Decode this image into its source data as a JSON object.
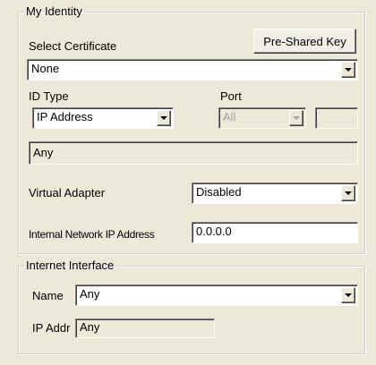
{
  "identity": {
    "legend": "My Identity",
    "select_certificate_label": "Select Certificate",
    "pre_shared_key_button": "Pre-Shared Key",
    "certificate_value": "None",
    "id_type_label": "ID Type",
    "id_type_value": "IP Address",
    "port_label": "Port",
    "port_value": "All",
    "port_extra_value": "",
    "id_value": "Any",
    "virtual_adapter_label": "Virtual Adapter",
    "virtual_adapter_value": "Disabled",
    "internal_ip_label": "Internal Network IP Address",
    "internal_ip_value": "0.0.0.0"
  },
  "internet": {
    "legend": "Internet Interface",
    "name_label": "Name",
    "name_value": "Any",
    "ip_addr_label": "IP Addr",
    "ip_addr_value": "Any"
  },
  "icons": {
    "dropdown": "chevron-down-icon"
  }
}
